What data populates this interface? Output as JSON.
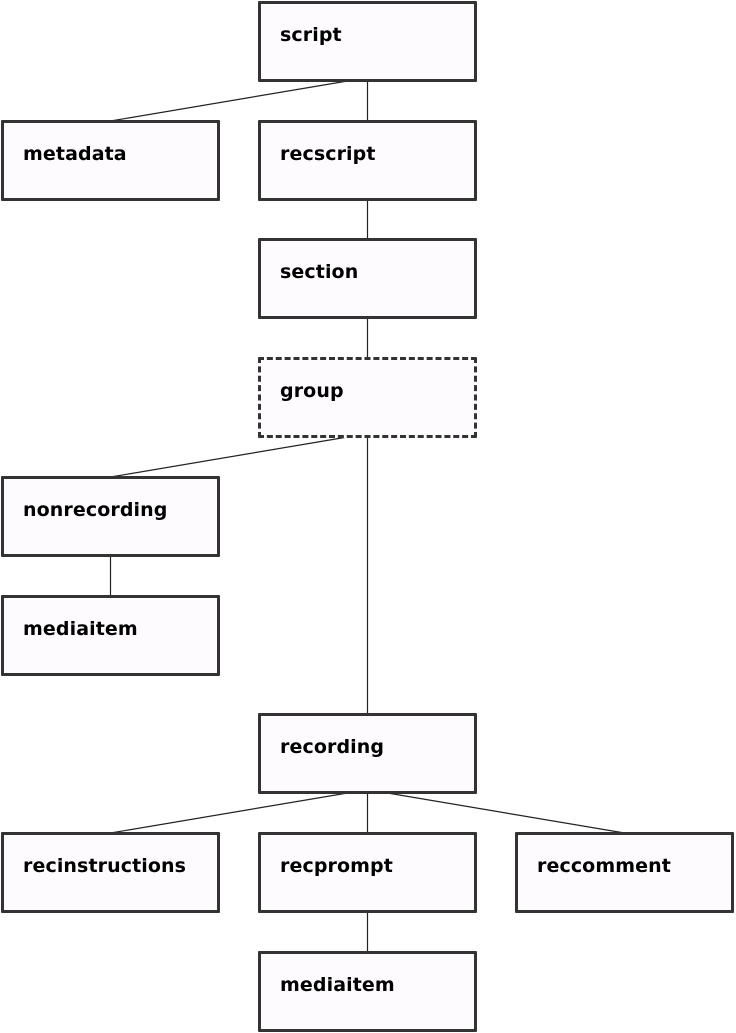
{
  "diagram": {
    "type": "tree",
    "colors": {
      "border": "#333333",
      "fill": "#fdfbfd",
      "edge": "#222222",
      "text": "#000000"
    },
    "nodes": [
      {
        "id": "script",
        "label": "script",
        "style": "solid"
      },
      {
        "id": "metadata",
        "label": "metadata",
        "style": "solid"
      },
      {
        "id": "recscript",
        "label": "recscript",
        "style": "solid"
      },
      {
        "id": "section",
        "label": "section",
        "style": "solid"
      },
      {
        "id": "group",
        "label": "group",
        "style": "dashed"
      },
      {
        "id": "nonrecording",
        "label": "nonrecording",
        "style": "solid"
      },
      {
        "id": "mediaitem1",
        "label": "mediaitem",
        "style": "solid"
      },
      {
        "id": "recording",
        "label": "recording",
        "style": "solid"
      },
      {
        "id": "recinstructions",
        "label": "recinstructions",
        "style": "solid"
      },
      {
        "id": "recprompt",
        "label": "recprompt",
        "style": "solid"
      },
      {
        "id": "reccomment",
        "label": "reccomment",
        "style": "solid"
      },
      {
        "id": "mediaitem2",
        "label": "mediaitem",
        "style": "solid"
      }
    ],
    "edges": [
      [
        "script",
        "metadata"
      ],
      [
        "script",
        "recscript"
      ],
      [
        "recscript",
        "section"
      ],
      [
        "section",
        "group"
      ],
      [
        "group",
        "nonrecording"
      ],
      [
        "group",
        "recording"
      ],
      [
        "nonrecording",
        "mediaitem1"
      ],
      [
        "recording",
        "recinstructions"
      ],
      [
        "recording",
        "recprompt"
      ],
      [
        "recording",
        "reccomment"
      ],
      [
        "recprompt",
        "mediaitem2"
      ]
    ]
  }
}
